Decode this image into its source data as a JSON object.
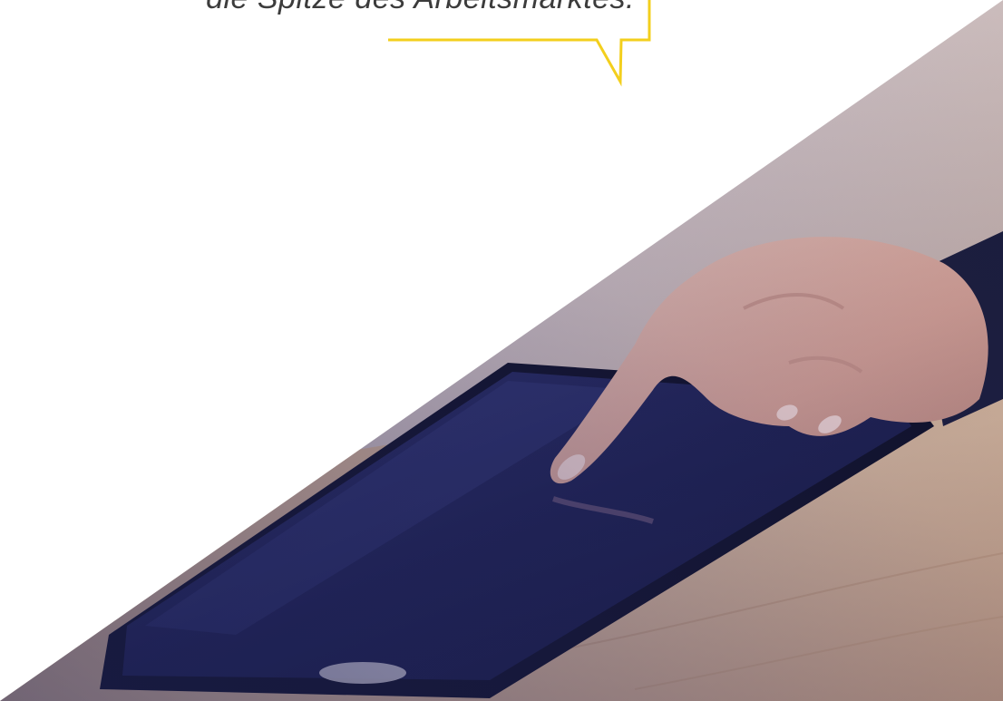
{
  "quote": {
    "text": "die Spitze des Arbeitsmarktes."
  },
  "colors": {
    "accent": "#f3cf1d",
    "quote_text": "#3c3c3c",
    "background": "#ffffff",
    "tablet_screen": "#1f2357",
    "overlay_tint": "#2c2f6e",
    "desk_wood": "#c7a488"
  },
  "photo": {
    "subject": "hand-touching-tablet-photo"
  }
}
